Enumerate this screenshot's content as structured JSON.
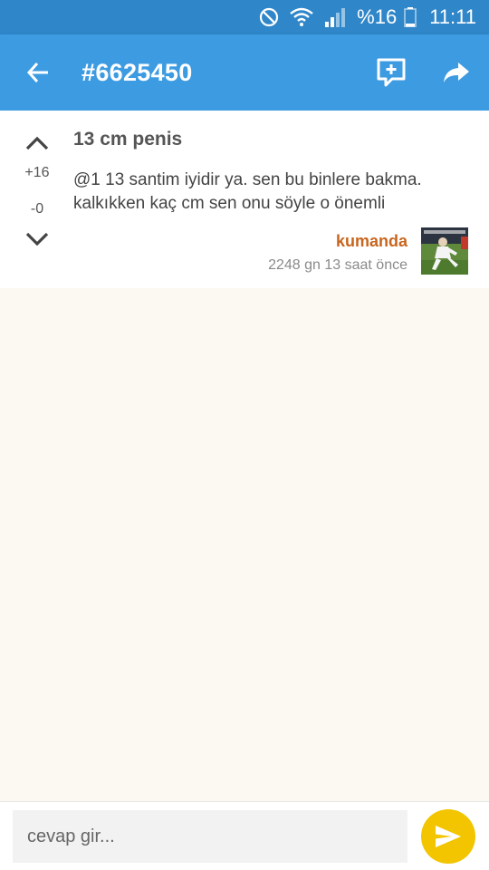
{
  "status_bar": {
    "battery_text": "%16",
    "time": "11:11",
    "icons": [
      "do-not-disturb-icon",
      "wifi-icon",
      "signal-icon",
      "battery-icon"
    ]
  },
  "app_bar": {
    "title": "#6625450",
    "back_icon": "arrow-left-icon",
    "add_comment_icon": "comment-add-icon",
    "share_icon": "share-icon"
  },
  "entry": {
    "title": "13 cm penis",
    "body": "@1 13 santim iyidir ya. sen bu binlere bakma. kalkıkken kaç cm sen onu söyle o önemli",
    "upvotes": "+16",
    "downvotes": "-0",
    "author": "kumanda",
    "time": "2248 gn 13 saat  önce",
    "avatar_icon": "user-avatar"
  },
  "reply": {
    "placeholder": "cevap gir...",
    "send_icon": "send-icon"
  },
  "colors": {
    "status_bar": "#2f86c9",
    "app_bar": "#3d9be2",
    "author": "#c8651d",
    "send_button": "#f2c500",
    "background": "#fbf9f1"
  }
}
